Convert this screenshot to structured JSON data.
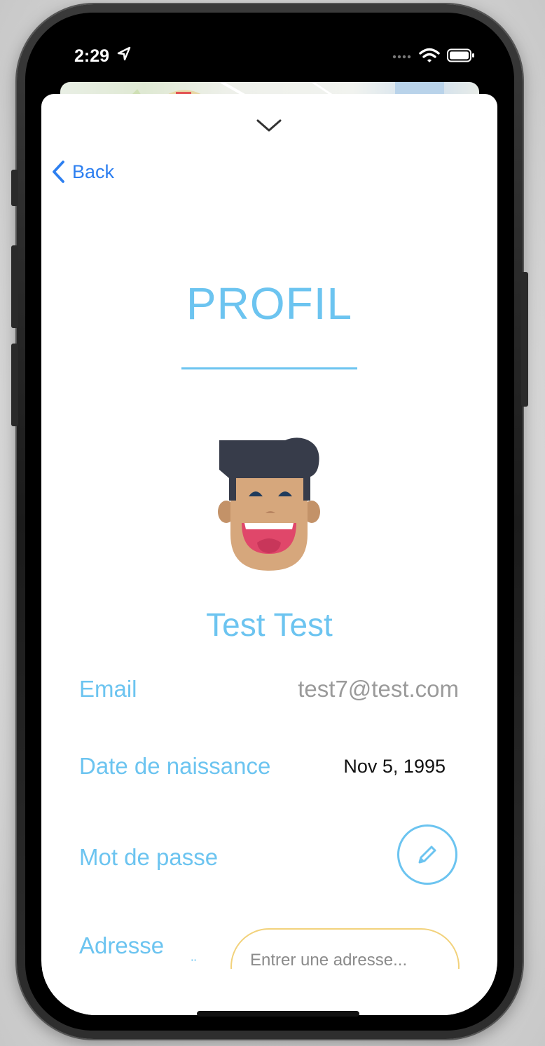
{
  "status_bar": {
    "time": "2:29"
  },
  "nav": {
    "back_label": "Back"
  },
  "profile": {
    "title": "PROFIL",
    "name": "Test Test"
  },
  "fields": {
    "email_label": "Email",
    "email_value": "test7@test.com",
    "dob_label": "Date de naissance",
    "dob_value": "Nov 5, 1995",
    "password_label": "Mot de passe",
    "address_label": "Adresse",
    "address_placeholder": "Entrer une adresse..."
  },
  "colors": {
    "accent": "#6cc4f0",
    "link": "#2d7ff0",
    "input_border": "#f2d27c"
  },
  "icons": {
    "dismiss": "chevron-down-icon",
    "back": "chevron-left-icon",
    "edit": "pencil-icon"
  }
}
